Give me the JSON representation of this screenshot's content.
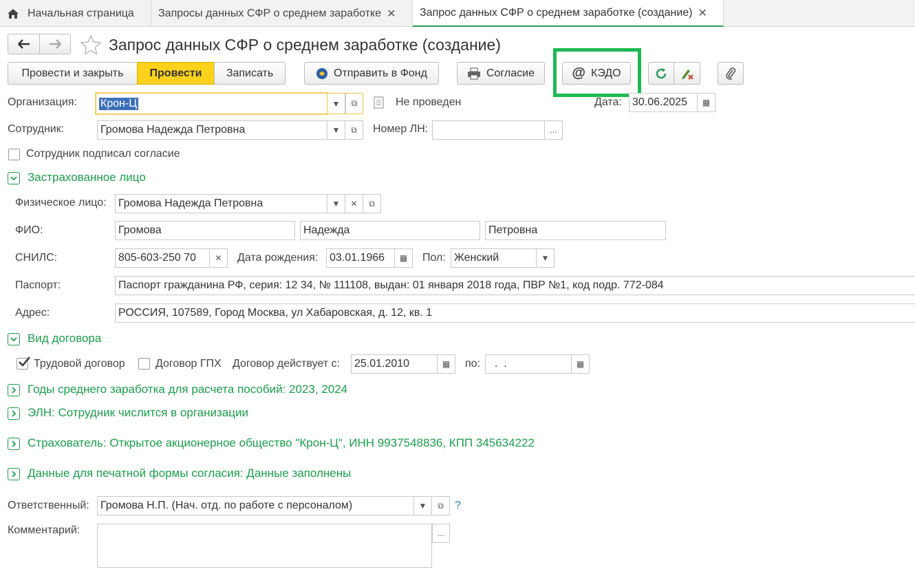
{
  "tabs": [
    {
      "label": "Начальная страница"
    },
    {
      "label": "Запросы данных СФР о среднем заработке"
    },
    {
      "label": "Запрос данных СФР о среднем заработке (создание)"
    }
  ],
  "window": {
    "title": "Запрос данных СФР о среднем заработке (создание)"
  },
  "toolbar": {
    "post_and_close": "Провести и закрыть",
    "post": "Провести",
    "save": "Записать",
    "send_to_fund": "Отправить в Фонд",
    "consent": "Согласие",
    "kedo": "КЭДО"
  },
  "form": {
    "organization_label": "Организация:",
    "organization_value": "Крон-Ц",
    "status": "Не проведен",
    "date_label": "Дата:",
    "date_value": "30.06.2025",
    "employee_label": "Сотрудник:",
    "employee_value": "Громова Надежда Петровна",
    "ln_label": "Номер ЛН:",
    "ln_value": "",
    "ln_btn": "...",
    "consent_signed_label": "Сотрудник подписал согласие"
  },
  "insured": {
    "header": "Застрахованное лицо",
    "person_label": "Физическое лицо:",
    "person_value": "Громова Надежда Петровна",
    "fio_label": "ФИО:",
    "last_name": "Громова",
    "first_name": "Надежда",
    "middle_name": "Петровна",
    "snils_label": "СНИЛС:",
    "snils_value": "805-603-250 70",
    "birth_label": "Дата рождения:",
    "birth_value": "03.01.1966",
    "sex_label": "Пол:",
    "sex_value": "Женский",
    "passport_label": "Паспорт:",
    "passport_value": "Паспорт гражданина РФ, серия: 12 34, № 111108, выдан: 01 января 2018 года, ПВР №1, код подр. 772-084",
    "address_label": "Адрес:",
    "address_value": "РОССИЯ, 107589, Город Москва, ул Хабаровская, д. 12, кв. 1"
  },
  "contract": {
    "header": "Вид договора",
    "labor_label": "Трудовой договор",
    "labor_checked": true,
    "gph_label": "Договор ГПХ",
    "gph_checked": false,
    "valid_from_label": "Договор действует с:",
    "valid_from_value": "25.01.2010",
    "to_label": "по:",
    "to_value": "  .  ."
  },
  "sections": {
    "years": "Годы среднего заработка для расчета пособий: 2023, 2024",
    "eln": "ЭЛН: Сотрудник числится в организации",
    "insurer": "Страхователь: Открытое акционерное общество \"Крон-Ц\", ИНН 9937548836, КПП 345634222",
    "print_data": "Данные для печатной формы согласия: Данные заполнены"
  },
  "footer": {
    "responsible_label": "Ответственный:",
    "responsible_value": "Громова Н.П. (Нач. отд. по работе с персоналом)",
    "help": "?",
    "comment_label": "Комментарий:",
    "comment_value": "",
    "comment_btn": "..."
  },
  "colors": {
    "accent": "#1b9e4b",
    "primary_button": "#fcd21c",
    "highlight": "#1db954"
  }
}
